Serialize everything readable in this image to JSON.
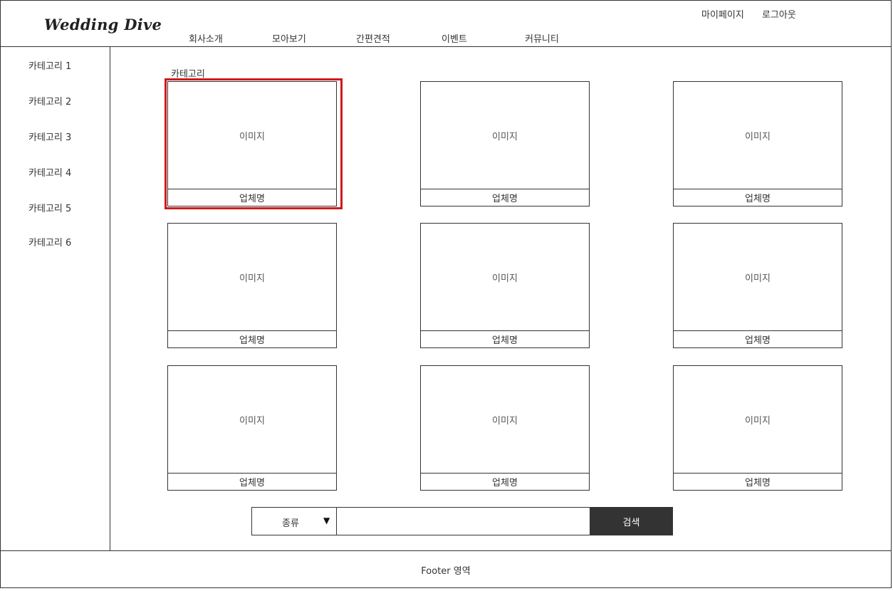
{
  "logo": "Wedding Dive",
  "nav": [
    "회사소개",
    "모아보기",
    "간편견적",
    "이벤트",
    "커뮤니티"
  ],
  "util": {
    "mypage": "마이페이지",
    "logout": "로그아웃"
  },
  "sidebar": [
    "카테고리 1",
    "카테고리 2",
    "카테고리 3",
    "카테고리 4",
    "카테고리 5",
    "카테고리 6"
  ],
  "category_title": "카테고리",
  "cards": [
    {
      "image": "이미지",
      "name": "업체명"
    },
    {
      "image": "이미지",
      "name": "업체명"
    },
    {
      "image": "이미지",
      "name": "업체명"
    },
    {
      "image": "이미지",
      "name": "업체명"
    },
    {
      "image": "이미지",
      "name": "업체명"
    },
    {
      "image": "이미지",
      "name": "업체명"
    },
    {
      "image": "이미지",
      "name": "업체명"
    },
    {
      "image": "이미지",
      "name": "업체명"
    },
    {
      "image": "이미지",
      "name": "업체명"
    }
  ],
  "search": {
    "select_label": "종류",
    "arrow": "▼",
    "input_value": "",
    "button": "검색"
  },
  "footer": "Footer 영역",
  "colors": {
    "highlight": "#d11a1a",
    "button_bg": "#333333"
  }
}
